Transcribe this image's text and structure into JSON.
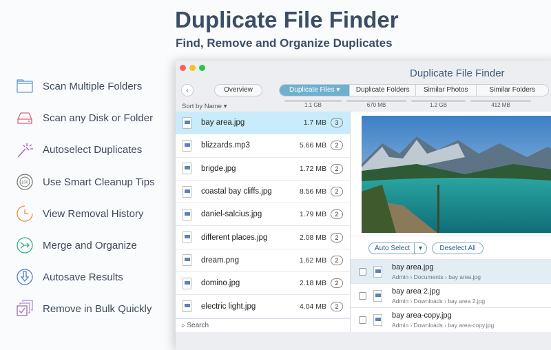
{
  "headline": "Duplicate File Finder",
  "subheadline": "Find, Remove and Organize Duplicates",
  "features": [
    {
      "label": "Scan Multiple Folders",
      "icon": "folder-icon",
      "color": "#5b9bd5"
    },
    {
      "label": "Scan any Disk or Folder",
      "icon": "disk-icon",
      "color": "#e0607a"
    },
    {
      "label": "Autoselect Duplicates",
      "icon": "magic-wand-icon",
      "color": "#b04fd0"
    },
    {
      "label": "Use Smart Cleanup Tips",
      "icon": "chip-100-icon",
      "color": "#777777"
    },
    {
      "label": "View Removal History",
      "icon": "clock-icon",
      "color": "#e89040"
    },
    {
      "label": "Merge and Organize",
      "icon": "merge-icon",
      "color": "#2fb07a"
    },
    {
      "label": "Autosave Results",
      "icon": "download-icon",
      "color": "#4a7fd0"
    },
    {
      "label": "Remove in Bulk Quickly",
      "icon": "stack-check-icon",
      "color": "#9a70c0"
    }
  ],
  "window": {
    "title": "Duplicate File Finder",
    "overview": "Overview",
    "tabs": [
      {
        "label": "Duplicate Files ▾",
        "size": "1.1 GB",
        "active": true
      },
      {
        "label": "Duplicate Folders",
        "size": "670 MB"
      },
      {
        "label": "Similar Photos",
        "size": "1.2 GB"
      },
      {
        "label": "Similar Folders",
        "size": "412 MB"
      }
    ],
    "sort": "Sort by Name ▾",
    "files": [
      {
        "name": "bay area.jpg",
        "size": "1.7 MB",
        "count": "3"
      },
      {
        "name": "blizzards.mp3",
        "size": "5.66 MB",
        "count": "2"
      },
      {
        "name": "brigde.jpg",
        "size": "1.72 MB",
        "count": "2"
      },
      {
        "name": "coastal bay cliffs.jpg",
        "size": "8.56 MB",
        "count": "2"
      },
      {
        "name": "daniel-salcius.jpg",
        "size": "1.79 MB",
        "count": "2"
      },
      {
        "name": "different places.jpg",
        "size": "2.08 MB",
        "count": "2"
      },
      {
        "name": "dream.png",
        "size": "1.62 MB",
        "count": "2"
      },
      {
        "name": "domino.jpg",
        "size": "2.18 MB",
        "count": "2"
      },
      {
        "name": "electric light.jpg",
        "size": "4.04 MB",
        "count": "2"
      }
    ],
    "search": "Search",
    "auto_select": "Auto Select",
    "deselect_all": "Deselect All",
    "duplicates": [
      {
        "name": "bay area.jpg",
        "path": "Admin  › Documents  › bay area.jpg"
      },
      {
        "name": "bay area 2.jpg",
        "path": "Admin  › Downloads  › bay area 2.jpg"
      },
      {
        "name": "bay area-copy.jpg",
        "path": "Admin  › Downloads  › bay area-copy.jpg"
      }
    ]
  }
}
